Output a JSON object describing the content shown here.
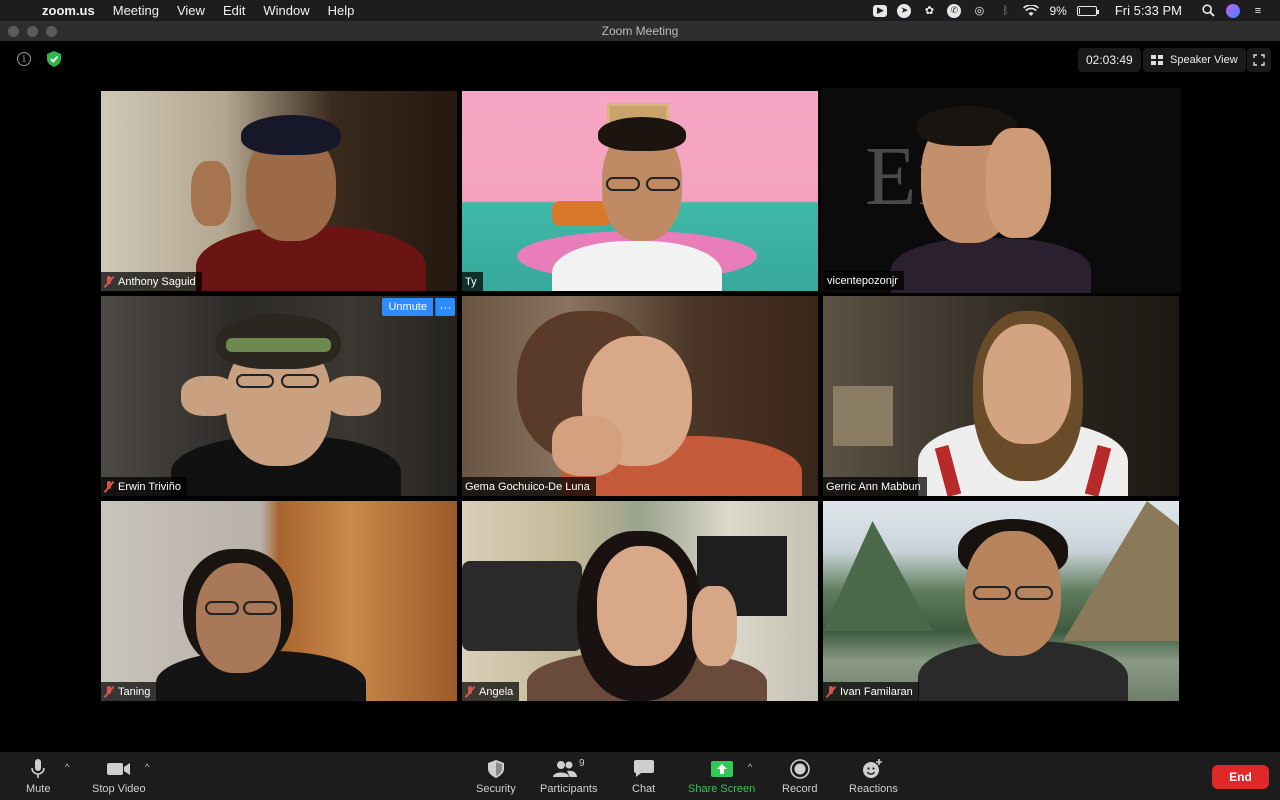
{
  "menubar": {
    "app_name": "zoom.us",
    "menus": [
      "Meeting",
      "View",
      "Edit",
      "Window",
      "Help"
    ],
    "battery": "9%",
    "battery_level": 0.09,
    "clock": "Fri 5:33 PM"
  },
  "window": {
    "title": "Zoom Meeting"
  },
  "topbar": {
    "timer": "02:03:49",
    "view_label": "Speaker View"
  },
  "tiles": [
    {
      "name": "Anthony Saguid",
      "muted": true
    },
    {
      "name": "Ty",
      "muted": false
    },
    {
      "name": "vicentepozonjr",
      "muted": false,
      "active_speaker": true,
      "bg_text": "Enna"
    },
    {
      "name": "Erwin Triviño",
      "muted": true,
      "unmute_label": "Unmute",
      "more_label": "···"
    },
    {
      "name": "Gema Gochuico-De Luna",
      "muted": false
    },
    {
      "name": "Gerric Ann Mabbun",
      "muted": false
    },
    {
      "name": "Taning",
      "muted": true
    },
    {
      "name": "Angela",
      "muted": true
    },
    {
      "name": "Ivan Familaran",
      "muted": true
    }
  ],
  "toolbar": {
    "mute": "Mute",
    "stop_video": "Stop Video",
    "security": "Security",
    "participants": "Participants",
    "participants_count": "9",
    "chat": "Chat",
    "share_screen": "Share Screen",
    "record": "Record",
    "reactions": "Reactions",
    "end": "End"
  },
  "colors": {
    "accent_blue": "#2d8cff",
    "share_green": "#34c759",
    "end_red": "#e02828",
    "active_speaker_border": "#d9dd8a",
    "muted_red": "#d9534f"
  }
}
